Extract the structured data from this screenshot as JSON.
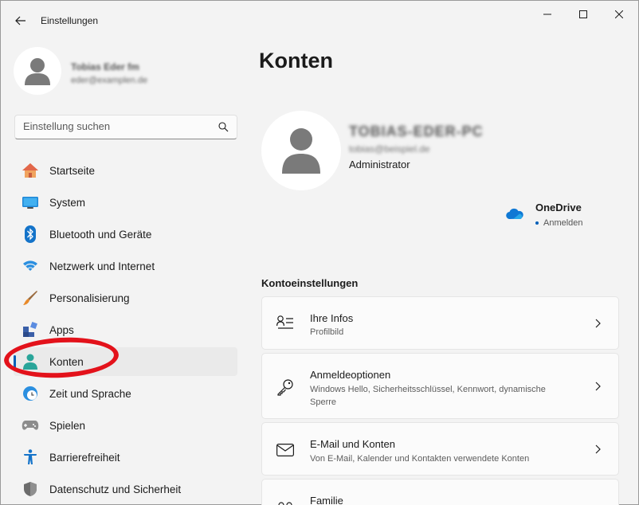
{
  "window": {
    "title": "Einstellungen"
  },
  "profile": {
    "name": "Tobias Eder fm",
    "email": "eder@examplen.de"
  },
  "search": {
    "placeholder": "Einstellung suchen"
  },
  "nav": {
    "items": [
      {
        "label": "Startseite",
        "icon": "home-icon"
      },
      {
        "label": "System",
        "icon": "display-icon"
      },
      {
        "label": "Bluetooth und Geräte",
        "icon": "bluetooth-icon"
      },
      {
        "label": "Netzwerk und Internet",
        "icon": "wifi-icon"
      },
      {
        "label": "Personalisierung",
        "icon": "brush-icon"
      },
      {
        "label": "Apps",
        "icon": "apps-icon"
      },
      {
        "label": "Konten",
        "icon": "user-icon",
        "active": true
      },
      {
        "label": "Zeit und Sprache",
        "icon": "clock-globe-icon"
      },
      {
        "label": "Spielen",
        "icon": "gamepad-icon"
      },
      {
        "label": "Barrierefreiheit",
        "icon": "accessibility-icon"
      },
      {
        "label": "Datenschutz und Sicherheit",
        "icon": "shield-icon"
      }
    ]
  },
  "main": {
    "title": "Konten",
    "account": {
      "name": "TOBIAS-EDER-PC",
      "email": "tobias@beispiel.de",
      "role": "Administrator"
    },
    "onedrive": {
      "title": "OneDrive",
      "status": "Anmelden"
    },
    "section_title": "Kontoeinstellungen",
    "cards": [
      {
        "title": "Ihre Infos",
        "subtitle": "Profilbild",
        "icon": "person-lines-icon"
      },
      {
        "title": "Anmeldeoptionen",
        "subtitle": "Windows Hello, Sicherheitsschlüssel, Kennwort, dynamische Sperre",
        "icon": "key-icon"
      },
      {
        "title": "E-Mail und Konten",
        "subtitle": "Von E-Mail, Kalender und Kontakten verwendete Konten",
        "icon": "mail-icon"
      },
      {
        "title": "Familie",
        "subtitle": "",
        "icon": "family-icon"
      }
    ]
  },
  "colors": {
    "accent": "#005fb8",
    "annotation": "#e3121b",
    "background": "#f3f3f3"
  }
}
